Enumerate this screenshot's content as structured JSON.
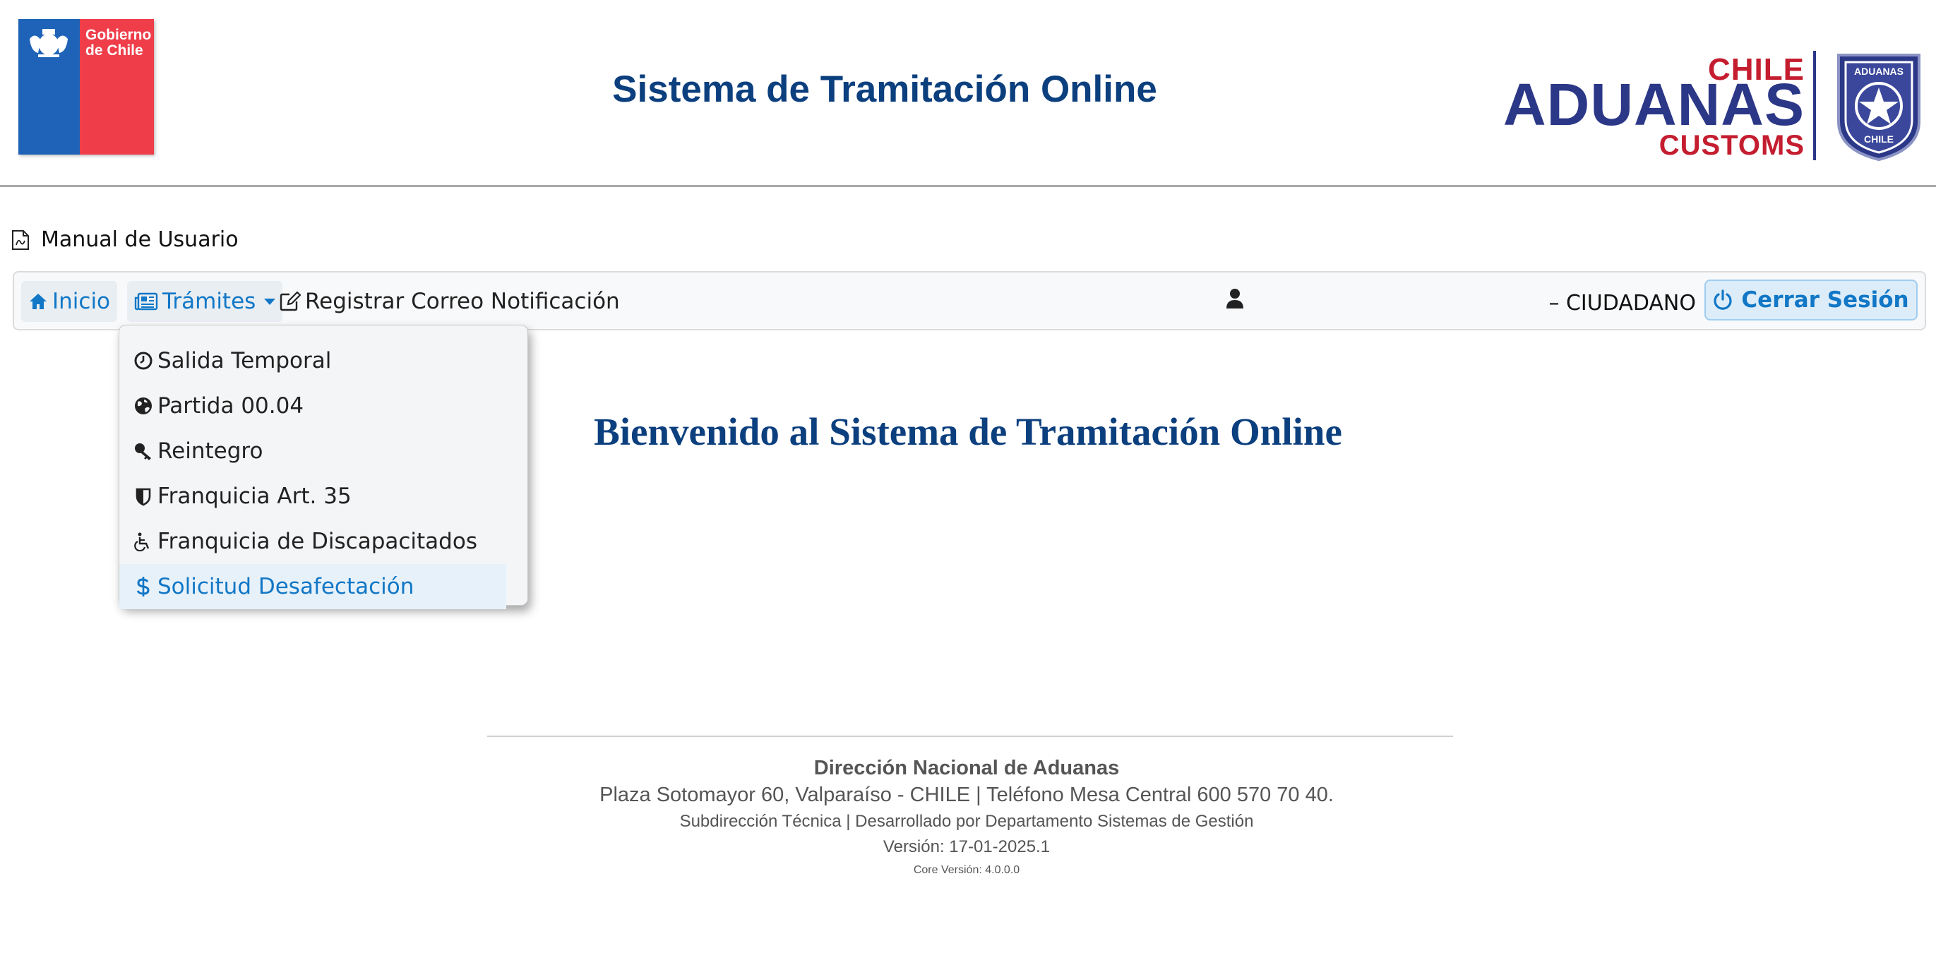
{
  "header": {
    "gob_logo_text": "Gobierno\nde Chile",
    "title": "Sistema de Tramitación Online",
    "aduanas_logo": {
      "chile": "CHILE",
      "aduanas": "ADUANAS",
      "customs": "CUSTOMS",
      "shield_top": "ADUANAS",
      "shield_bottom": "CHILE"
    }
  },
  "manual": {
    "label": "Manual de Usuario",
    "icon": "pdf-icon"
  },
  "navbar": {
    "inicio": "Inicio",
    "tramites": "Trámites",
    "registrar": "Registrar Correo Notificación",
    "role": "– CIUDADANO",
    "logout": "Cerrar Sesión"
  },
  "dropdown": {
    "items": [
      {
        "label": "Salida Temporal",
        "icon": "clock-icon"
      },
      {
        "label": "Partida 00.04",
        "icon": "globe-icon"
      },
      {
        "label": "Reintegro",
        "icon": "key-icon"
      },
      {
        "label": "Franquicia Art. 35",
        "icon": "shield-icon"
      },
      {
        "label": "Franquicia de Discapacitados",
        "icon": "wheelchair-icon"
      },
      {
        "label": "Solicitud Desafectación",
        "icon": "dollar-icon"
      }
    ]
  },
  "welcome": "Bienvenido al Sistema de Tramitación Online",
  "footer": {
    "org": "Dirección Nacional de Aduanas",
    "address": "Plaza Sotomayor 60, Valparaíso - CHILE | Teléfono Mesa Central 600 570 70 40.",
    "dept": "Subdirección Técnica | Desarrollado por Departamento Sistemas de Gestión",
    "version": "Versión: 17-01-2025.1",
    "core_version": "Core Versión: 4.0.0.0"
  },
  "colors": {
    "primary_blue": "#0c3f7e",
    "link_blue": "#1177c6",
    "gob_blue": "#1f63b8",
    "gob_red": "#ef3e4a",
    "aduanas_navy": "#2b3787",
    "aduanas_red": "#c41d2f"
  }
}
